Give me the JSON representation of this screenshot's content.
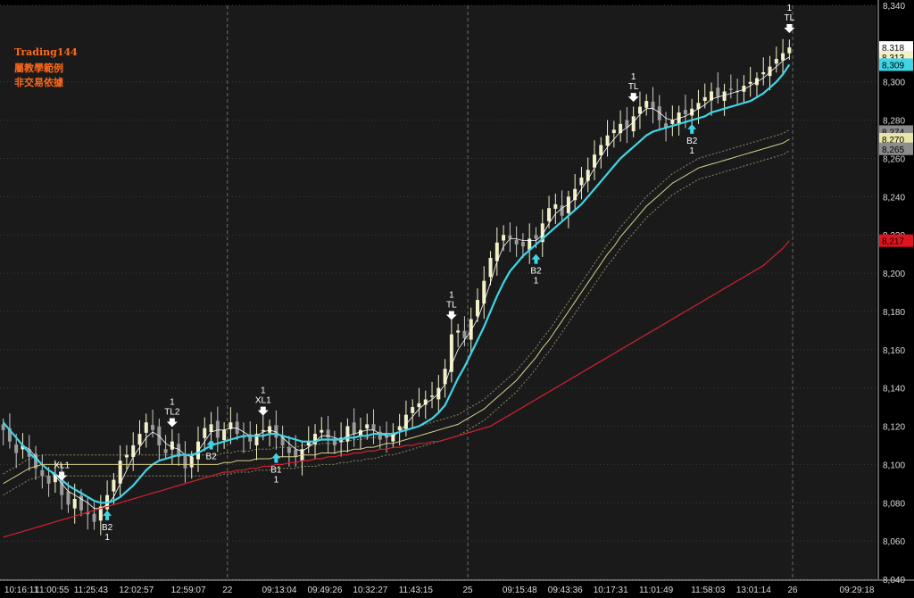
{
  "watermark": [
    "Trading144",
    "屬教學範例",
    "非交易依據"
  ],
  "colors": {
    "background": "#1a1a1a",
    "candle_up": "#f2f0c8",
    "candle_down": "#c8c8c8",
    "ma_fast": "#ffffff",
    "ma_cyan": "#3fd5e6",
    "ma_yellow": "#d9d28a",
    "ma_red": "#d42030",
    "band": "#8a8a6a",
    "signal": "#ffffff",
    "signal_buy": "#3fd5e6"
  },
  "chart_data": {
    "type": "candlestick",
    "y_axis": {
      "range": [
        8040,
        8340
      ],
      "ticks": [
        "8,340",
        "8,300",
        "8,280",
        "8,260",
        "8,240",
        "8,220",
        "8,200",
        "8,180",
        "8,160",
        "8,140",
        "8,120",
        "8,100",
        "8,080",
        "8,060",
        "8,040"
      ],
      "tick_values": [
        8340,
        8300,
        8280,
        8260,
        8240,
        8220,
        8200,
        8180,
        8160,
        8140,
        8120,
        8100,
        8080,
        8060,
        8040
      ]
    },
    "x_axis": {
      "labels": [
        "10:16:11",
        "11:00:55",
        "11:25:43",
        "12:02:57",
        "12:59:07",
        "22",
        "09:13:04",
        "09:49:26",
        "10:32:27",
        "11:43:15",
        "25",
        "09:15:48",
        "09:43:36",
        "10:17:31",
        "11:01:49",
        "11:58:03",
        "13:01:14",
        "26",
        "09:29:18"
      ],
      "label_positions": [
        0.4,
        8,
        14,
        21,
        29,
        35,
        43,
        50,
        57,
        64,
        72,
        80,
        87,
        94,
        101,
        109,
        116,
        122,
        134
      ],
      "session_breaks": [
        35,
        72,
        122
      ]
    },
    "close": [
      8118,
      8112,
      8106,
      8110,
      8104,
      8098,
      8094,
      8090,
      8095,
      8084,
      8079,
      8082,
      8076,
      8074,
      8070,
      8078,
      8084,
      8092,
      8102,
      8105,
      8110,
      8116,
      8122,
      8118,
      8110,
      8106,
      8112,
      8104,
      8098,
      8104,
      8112,
      8119,
      8121,
      8114,
      8118,
      8122,
      8116,
      8114,
      8112,
      8116,
      8118,
      8120,
      8114,
      8110,
      8106,
      8104,
      8108,
      8112,
      8116,
      8118,
      8114,
      8110,
      8114,
      8120,
      8116,
      8118,
      8121,
      8118,
      8113,
      8114,
      8116,
      8120,
      8126,
      8130,
      8132,
      8134,
      8136,
      8140,
      8150,
      8168,
      8170,
      8166,
      8176,
      8186,
      8196,
      8208,
      8216,
      8220,
      8218,
      8215,
      8214,
      8218,
      8218,
      8226,
      8234,
      8236,
      8230,
      8240,
      8244,
      8250,
      8254,
      8262,
      8267,
      8272,
      8275,
      8278,
      8276,
      8282,
      8287,
      8290,
      8286,
      8280,
      8276,
      8280,
      8284,
      8283,
      8286,
      8289,
      8292,
      8295,
      8292,
      8295,
      8296,
      8295,
      8298,
      8300,
      8302,
      8305,
      8308,
      8312,
      8315,
      8318
    ],
    "series": [
      {
        "name": "",
        "color_key": "ma_fast",
        "values": [
          8122,
          8118,
          8114,
          8110,
          8108,
          8104,
          8100,
          8097,
          8094,
          8090,
          8086,
          8084,
          8082,
          8080,
          8077,
          8077,
          8079,
          8083,
          8090,
          8097,
          8104,
          8109,
          8114,
          8117,
          8115,
          8111,
          8109,
          8108,
          8105,
          8104,
          8107,
          8112,
          8117,
          8118,
          8118,
          8119,
          8119,
          8117,
          8115,
          8115,
          8117,
          8118,
          8117,
          8114,
          8111,
          8108,
          8107,
          8109,
          8112,
          8115,
          8115,
          8114,
          8113,
          8115,
          8116,
          8117,
          8118,
          8118,
          8116,
          8115,
          8115,
          8117,
          8121,
          8125,
          8129,
          8132,
          8134,
          8137,
          8142,
          8152,
          8160,
          8165,
          8170,
          8176,
          8185,
          8195,
          8206,
          8214,
          8218,
          8218,
          8217,
          8217,
          8217,
          8220,
          8226,
          8231,
          8234,
          8236,
          8239,
          8244,
          8249,
          8255,
          8261,
          8266,
          8270,
          8274,
          8276,
          8279,
          8283,
          8286,
          8286,
          8284,
          8281,
          8280,
          8281,
          8282,
          8284,
          8286,
          8288,
          8291,
          8292,
          8293,
          8294,
          8295,
          8296,
          8298,
          8300,
          8302,
          8305,
          8308,
          8311,
          8313
        ]
      },
      {
        "name": "",
        "color_key": "ma_cyan",
        "values": [
          8122,
          8118,
          8114,
          8110,
          8106,
          8103,
          8100,
          8097,
          8095,
          8092,
          8089,
          8087,
          8085,
          8083,
          8081,
          8080,
          8080,
          8081,
          8083,
          8086,
          8089,
          8093,
          8097,
          8100,
          8102,
          8103,
          8104,
          8105,
          8105,
          8105,
          8106,
          8108,
          8110,
          8111,
          8112,
          8113,
          8114,
          8115,
          8115,
          8115,
          8115,
          8116,
          8116,
          8115,
          8114,
          8113,
          8112,
          8112,
          8112,
          8113,
          8113,
          8113,
          8113,
          8114,
          8114,
          8115,
          8115,
          8116,
          8116,
          8116,
          8116,
          8117,
          8118,
          8119,
          8120,
          8122,
          8124,
          8127,
          8131,
          8138,
          8145,
          8151,
          8158,
          8165,
          8172,
          8180,
          8188,
          8195,
          8201,
          8205,
          8209,
          8212,
          8215,
          8218,
          8221,
          8224,
          8227,
          8230,
          8233,
          8236,
          8240,
          8244,
          8248,
          8252,
          8256,
          8260,
          8263,
          8266,
          8269,
          8272,
          8274,
          8275,
          8276,
          8277,
          8278,
          8279,
          8280,
          8281,
          8282,
          8284,
          8285,
          8286,
          8287,
          8288,
          8289,
          8290,
          8292,
          8294,
          8297,
          8300,
          8304,
          8309
        ]
      },
      {
        "name": "",
        "color_key": "ma_yellow",
        "values": [
          8090,
          8092,
          8094,
          8096,
          8098,
          8099,
          8100,
          8100,
          8100,
          8100,
          8100,
          8100,
          8100,
          8100,
          8100,
          8100,
          8100,
          8100,
          8100,
          8100,
          8100,
          8100,
          8100,
          8100,
          8100,
          8100,
          8100,
          8100,
          8100,
          8100,
          8100,
          8100,
          8100,
          8100,
          8101,
          8101,
          8102,
          8102,
          8102,
          8103,
          8103,
          8103,
          8104,
          8104,
          8104,
          8104,
          8105,
          8105,
          8105,
          8106,
          8106,
          8106,
          8107,
          8107,
          8108,
          8108,
          8109,
          8109,
          8110,
          8111,
          8111,
          8112,
          8113,
          8114,
          8115,
          8116,
          8117,
          8118,
          8119,
          8120,
          8121,
          8123,
          8125,
          8127,
          8129,
          8132,
          8135,
          8138,
          8141,
          8144,
          8148,
          8152,
          8156,
          8161,
          8165,
          8170,
          8175,
          8180,
          8185,
          8190,
          8195,
          8200,
          8205,
          8210,
          8214,
          8219,
          8223,
          8227,
          8231,
          8235,
          8238,
          8241,
          8244,
          8247,
          8249,
          8251,
          8253,
          8255,
          8256,
          8257,
          8258,
          8259,
          8260,
          8261,
          8262,
          8263,
          8264,
          8265,
          8266,
          8267,
          8268,
          8270
        ]
      },
      {
        "name": "",
        "color_key": "ma_red",
        "values": [
          8062,
          8063,
          8064,
          8065,
          8066,
          8067,
          8068,
          8069,
          8070,
          8071,
          8072,
          8073,
          8074,
          8075,
          8076,
          8077,
          8078,
          8079,
          8080,
          8081,
          8082,
          8083,
          8084,
          8085,
          8086,
          8087,
          8088,
          8089,
          8090,
          8091,
          8092,
          8093,
          8094,
          8095,
          8096,
          8096,
          8097,
          8097,
          8098,
          8098,
          8099,
          8099,
          8100,
          8100,
          8101,
          8101,
          8102,
          8102,
          8103,
          8103,
          8104,
          8104,
          8105,
          8105,
          8106,
          8106,
          8107,
          8107,
          8108,
          8108,
          8109,
          8109,
          8110,
          8110,
          8111,
          8111,
          8112,
          8112,
          8113,
          8114,
          8115,
          8116,
          8117,
          8118,
          8119,
          8120,
          8122,
          8124,
          8126,
          8128,
          8130,
          8132,
          8134,
          8136,
          8138,
          8140,
          8142,
          8144,
          8146,
          8148,
          8150,
          8152,
          8154,
          8156,
          8158,
          8160,
          8162,
          8164,
          8166,
          8168,
          8170,
          8172,
          8174,
          8176,
          8178,
          8180,
          8182,
          8184,
          8186,
          8188,
          8190,
          8192,
          8194,
          8196,
          8198,
          8200,
          8202,
          8204,
          8207,
          8210,
          8213,
          8217
        ]
      }
    ],
    "price_tags": [
      {
        "text": "8,318",
        "value": 8318,
        "bg": "#ffffff",
        "fg": "#000000"
      },
      {
        "text": "8,313",
        "value": 8313,
        "bg": "#f2f0c8",
        "fg": "#000000"
      },
      {
        "text": "8,309",
        "value": 8309,
        "bg": "#3fd5e6",
        "fg": "#000000"
      },
      {
        "text": "8,274",
        "value": 8274,
        "bg": "#8c8c8c",
        "fg": "#000000"
      },
      {
        "text": "8,270",
        "value": 8270,
        "bg": "#e8e6a8",
        "fg": "#000000"
      },
      {
        "text": "8,265",
        "value": 8265,
        "bg": "#8c8c8c",
        "fg": "#000000"
      },
      {
        "text": "8,217",
        "value": 8217,
        "bg": "#e0141e",
        "fg": "#000000"
      }
    ],
    "signals": [
      {
        "bar": 9,
        "type": "sell",
        "text": "XL1",
        "num": ""
      },
      {
        "bar": 16,
        "type": "buy",
        "text": "B2",
        "num": "1"
      },
      {
        "bar": 26,
        "type": "sell",
        "text": "TL2",
        "num": "1"
      },
      {
        "bar": 32,
        "type": "buy",
        "text": "B2",
        "num": ""
      },
      {
        "bar": 40,
        "type": "sell",
        "text": "XL1",
        "num": "1"
      },
      {
        "bar": 42,
        "type": "buy",
        "text": "B1",
        "num": "1"
      },
      {
        "bar": 69,
        "type": "sell",
        "text": "TL",
        "num": "1"
      },
      {
        "bar": 82,
        "type": "buy",
        "text": "B2",
        "num": "1"
      },
      {
        "bar": 97,
        "type": "sell",
        "text": "TL",
        "num": "1"
      },
      {
        "bar": 106,
        "type": "buy",
        "text": "B2",
        "num": "1"
      },
      {
        "bar": 121,
        "type": "sell",
        "text": "TL",
        "num": "1"
      }
    ]
  }
}
